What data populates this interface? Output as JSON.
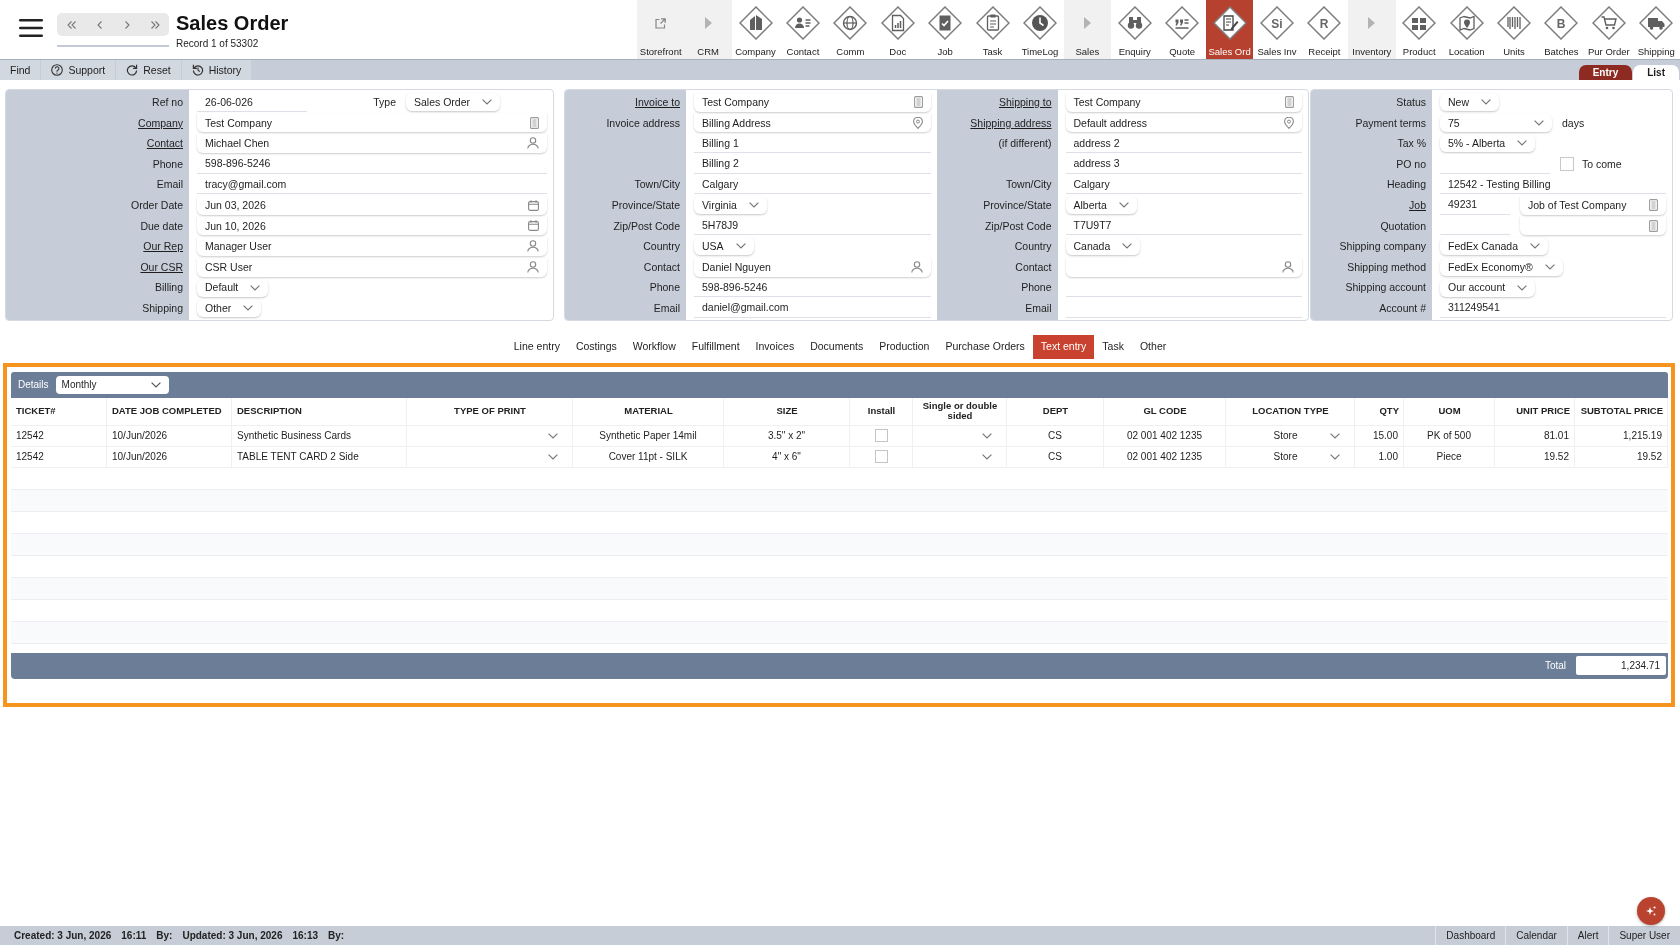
{
  "header": {
    "title": "Sales Order",
    "record": "Record 1 of 53302"
  },
  "toolbar": [
    {
      "label": "Storefront",
      "kind": "link",
      "selected": false
    },
    {
      "label": "CRM",
      "kind": "section",
      "selected": false
    },
    {
      "label": "Company",
      "kind": "module",
      "selected": false
    },
    {
      "label": "Contact",
      "kind": "module",
      "selected": false
    },
    {
      "label": "Comm",
      "kind": "module",
      "selected": false
    },
    {
      "label": "Doc",
      "kind": "module",
      "selected": false
    },
    {
      "label": "Job",
      "kind": "module",
      "selected": false
    },
    {
      "label": "Task",
      "kind": "module",
      "selected": false
    },
    {
      "label": "TimeLog",
      "kind": "module",
      "selected": false
    },
    {
      "label": "Sales",
      "kind": "section",
      "selected": false
    },
    {
      "label": "Enquiry",
      "kind": "module",
      "selected": false
    },
    {
      "label": "Quote",
      "kind": "module",
      "selected": false
    },
    {
      "label": "Sales Ord",
      "kind": "module",
      "selected": true
    },
    {
      "label": "Sales Inv",
      "kind": "module",
      "selected": false,
      "icon_text": "Si"
    },
    {
      "label": "Receipt",
      "kind": "module",
      "selected": false,
      "icon_text": "R"
    },
    {
      "label": "Inventory",
      "kind": "section",
      "selected": false
    },
    {
      "label": "Product",
      "kind": "module",
      "selected": false
    },
    {
      "label": "Location",
      "kind": "module",
      "selected": false
    },
    {
      "label": "Units",
      "kind": "module",
      "selected": false
    },
    {
      "label": "Batches",
      "kind": "module",
      "selected": false,
      "icon_text": "B"
    },
    {
      "label": "Pur Order",
      "kind": "module",
      "selected": false
    },
    {
      "label": "Shipping",
      "kind": "module",
      "selected": false
    }
  ],
  "actions": [
    "Find",
    "Support",
    "Reset",
    "History"
  ],
  "view_tabs": [
    {
      "label": "Entry",
      "selected": true
    },
    {
      "label": "List",
      "selected": false
    }
  ],
  "form": {
    "cards": [
      {
        "sections": [
          {
            "rows": [
              {
                "label": "Ref no",
                "link": false,
                "fields": [
                  {
                    "kind": "text",
                    "value": "26-06-026"
                  },
                  {
                    "kind": "caption",
                    "value": "Type"
                  },
                  {
                    "kind": "select",
                    "value": "Sales Order"
                  }
                ]
              },
              {
                "label": "Company",
                "link": true,
                "fields": [
                  {
                    "kind": "lookup",
                    "value": "Test Company"
                  }
                ]
              },
              {
                "label": "Contact",
                "link": true,
                "fields": [
                  {
                    "kind": "person",
                    "value": "Michael Chen"
                  }
                ]
              },
              {
                "label": "Phone",
                "link": false,
                "fields": [
                  {
                    "kind": "text",
                    "value": "598-896-5246"
                  }
                ]
              },
              {
                "label": "Email",
                "link": false,
                "fields": [
                  {
                    "kind": "text",
                    "value": "tracy@gmail.com"
                  }
                ]
              },
              {
                "label": "Order Date",
                "link": false,
                "fields": [
                  {
                    "kind": "date",
                    "value": "Jun 03, 2026"
                  }
                ]
              },
              {
                "label": "Due date",
                "link": false,
                "fields": [
                  {
                    "kind": "date",
                    "value": "Jun 10, 2026"
                  }
                ]
              },
              {
                "label": "Our Rep",
                "link": true,
                "fields": [
                  {
                    "kind": "person",
                    "value": "Manager User"
                  }
                ]
              },
              {
                "label": "Our CSR",
                "link": true,
                "fields": [
                  {
                    "kind": "person",
                    "value": "CSR User"
                  }
                ]
              },
              {
                "label": "Billing",
                "link": false,
                "fields": [
                  {
                    "kind": "select",
                    "value": "Default"
                  }
                ]
              },
              {
                "label": "Shipping",
                "link": false,
                "fields": [
                  {
                    "kind": "select",
                    "value": "Other"
                  }
                ]
              }
            ]
          }
        ]
      },
      {
        "sections": [
          {
            "rows": [
              {
                "label": "Invoice to",
                "link": true,
                "fields": [
                  {
                    "kind": "lookup",
                    "value": "Test Company"
                  }
                ]
              },
              {
                "label": "Invoice address",
                "link": false,
                "fields": [
                  {
                    "kind": "address",
                    "value": "Billing Address"
                  }
                ]
              },
              {
                "fields": [
                  {
                    "kind": "text",
                    "value": "Billing 1"
                  }
                ]
              },
              {
                "fields": [
                  {
                    "kind": "text",
                    "value": "Billing 2"
                  }
                ]
              },
              {
                "label": "Town/City",
                "link": false,
                "fields": [
                  {
                    "kind": "text",
                    "value": "Calgary"
                  }
                ]
              },
              {
                "label": "Province/State",
                "link": false,
                "fields": [
                  {
                    "kind": "select",
                    "value": "Virginia"
                  }
                ]
              },
              {
                "label": "Zip/Post Code",
                "link": false,
                "fields": [
                  {
                    "kind": "text",
                    "value": "5H78J9"
                  }
                ]
              },
              {
                "label": "Country",
                "link": false,
                "fields": [
                  {
                    "kind": "select",
                    "value": "USA"
                  }
                ]
              },
              {
                "label": "Contact",
                "link": false,
                "fields": [
                  {
                    "kind": "person",
                    "value": "Daniel Nguyen"
                  }
                ]
              },
              {
                "label": "Phone",
                "link": false,
                "fields": [
                  {
                    "kind": "text",
                    "value": "598-896-5246"
                  }
                ]
              },
              {
                "label": "Email",
                "link": false,
                "fields": [
                  {
                    "kind": "text",
                    "value": "daniel@gmail.com"
                  }
                ]
              }
            ]
          },
          {
            "rows": [
              {
                "label": "Shipping to",
                "link": true,
                "fields": [
                  {
                    "kind": "lookup",
                    "value": "Test Company"
                  }
                ]
              },
              {
                "label": "Shipping address",
                "link": true,
                "fields": [
                  {
                    "kind": "address",
                    "value": "Default address"
                  }
                ]
              },
              {
                "label": "(if different)",
                "link": false,
                "fields": [
                  {
                    "kind": "text",
                    "value": "address 2"
                  }
                ]
              },
              {
                "fields": [
                  {
                    "kind": "text",
                    "value": "address 3"
                  }
                ]
              },
              {
                "label": "Town/City",
                "link": false,
                "fields": [
                  {
                    "kind": "text",
                    "value": "Calgary"
                  }
                ]
              },
              {
                "label": "Province/State",
                "link": false,
                "fields": [
                  {
                    "kind": "select",
                    "value": "Alberta"
                  }
                ]
              },
              {
                "label": "Zip/Post Code",
                "link": false,
                "fields": [
                  {
                    "kind": "text",
                    "value": "T7U9T7"
                  }
                ]
              },
              {
                "label": "Country",
                "link": false,
                "fields": [
                  {
                    "kind": "select",
                    "value": "Canada"
                  }
                ]
              },
              {
                "label": "Contact",
                "link": false,
                "fields": [
                  {
                    "kind": "person"
                  }
                ]
              },
              {
                "label": "Phone",
                "link": false,
                "fields": [
                  {
                    "kind": "text"
                  }
                ]
              },
              {
                "label": "Email",
                "link": false,
                "fields": [
                  {
                    "kind": "text"
                  }
                ]
              }
            ]
          }
        ]
      },
      {
        "sections": [
          {
            "rows": [
              {
                "label": "Status",
                "link": false,
                "fields": [
                  {
                    "kind": "select",
                    "value": "New"
                  }
                ]
              },
              {
                "label": "Payment terms",
                "link": false,
                "fields": [
                  {
                    "kind": "select",
                    "value": "75"
                  },
                  {
                    "kind": "caption",
                    "value": "days"
                  }
                ]
              },
              {
                "label": "Tax %",
                "link": false,
                "fields": [
                  {
                    "kind": "select",
                    "value": "5% - Alberta"
                  }
                ]
              },
              {
                "label": "PO no",
                "link": false,
                "fields": [
                  {
                    "kind": "text"
                  },
                  {
                    "kind": "checkbox",
                    "label": "To come",
                    "checked": false
                  }
                ]
              },
              {
                "label": "Heading",
                "link": false,
                "fields": [
                  {
                    "kind": "text",
                    "value": "12542 - Testing Billing"
                  }
                ]
              },
              {
                "label": "Job",
                "link": true,
                "fields": [
                  {
                    "kind": "text",
                    "value": "49231"
                  },
                  {
                    "kind": "lookup",
                    "value": "Job of Test Company"
                  }
                ]
              },
              {
                "label": "Quotation",
                "link": false,
                "fields": [
                  {
                    "kind": "text"
                  },
                  {
                    "kind": "lookup"
                  }
                ]
              },
              {
                "label": "Shipping company",
                "link": false,
                "fields": [
                  {
                    "kind": "select",
                    "value": "FedEx Canada"
                  }
                ]
              },
              {
                "label": "Shipping method",
                "link": false,
                "fields": [
                  {
                    "kind": "select",
                    "value": "FedEx Economy®"
                  }
                ]
              },
              {
                "label": "Shipping account",
                "link": false,
                "fields": [
                  {
                    "kind": "select",
                    "value": "Our account"
                  }
                ]
              },
              {
                "label": "Account #",
                "link": false,
                "fields": [
                  {
                    "kind": "text",
                    "value": "311249541"
                  }
                ]
              }
            ]
          }
        ]
      }
    ]
  },
  "section_tabs": [
    {
      "label": "Line entry",
      "selected": false
    },
    {
      "label": "Costings",
      "selected": false
    },
    {
      "label": "Workflow",
      "selected": false
    },
    {
      "label": "Fulfillment",
      "selected": false
    },
    {
      "label": "Invoices",
      "selected": false
    },
    {
      "label": "Documents",
      "selected": false
    },
    {
      "label": "Production",
      "selected": false
    },
    {
      "label": "Purchase Orders",
      "selected": false
    },
    {
      "label": "Text entry",
      "selected": true
    },
    {
      "label": "Task",
      "selected": false
    },
    {
      "label": "Other",
      "selected": false
    }
  ],
  "grid": {
    "title": "Details",
    "period": "Monthly",
    "columns": [
      {
        "label": "TICKET#",
        "kind": "text"
      },
      {
        "label": "DATE JOB COMPLETED",
        "kind": "text"
      },
      {
        "label": "DESCRIPTION",
        "kind": "text"
      },
      {
        "label": "TYPE OF PRINT",
        "kind": "select"
      },
      {
        "label": "MATERIAL",
        "kind": "text"
      },
      {
        "label": "SIZE",
        "kind": "text"
      },
      {
        "label": "Install",
        "kind": "checkbox"
      },
      {
        "label": "Single or double sided",
        "kind": "select"
      },
      {
        "label": "DEPT",
        "kind": "text"
      },
      {
        "label": "GL CODE",
        "kind": "text"
      },
      {
        "label": "LOCATION TYPE",
        "kind": "select"
      },
      {
        "label": "QTY",
        "kind": "text"
      },
      {
        "label": "UOM",
        "kind": "text"
      },
      {
        "label": "UNIT PRICE",
        "kind": "text"
      },
      {
        "label": "SUBTOTAL PRICE",
        "kind": "text"
      }
    ],
    "rows": [
      {
        "cells": [
          {
            "value": "12542"
          },
          {
            "value": "10/Jun/2026"
          },
          {
            "value": "Synthetic Business Cards"
          },
          {},
          {
            "value": "Synthetic Paper 14mil"
          },
          {
            "value": "3.5\" x 2\""
          },
          {
            "checked": false
          },
          {},
          {
            "value": "CS"
          },
          {
            "value": "02 001 402 1235"
          },
          {
            "value": "Store"
          },
          {
            "value": "15.00"
          },
          {
            "value": "PK of 500"
          },
          {
            "value": "81.01"
          },
          {
            "value": "1,215.19"
          }
        ]
      },
      {
        "cells": [
          {
            "value": "12542"
          },
          {
            "value": "10/Jun/2026"
          },
          {
            "value": "TABLE TENT CARD 2 Side"
          },
          {},
          {
            "value": "Cover 11pt - SILK"
          },
          {
            "value": "4\" x 6\""
          },
          {
            "checked": false
          },
          {},
          {
            "value": "CS"
          },
          {
            "value": "02 001 402 1235"
          },
          {
            "value": "Store"
          },
          {
            "value": "1.00"
          },
          {
            "value": "Piece"
          },
          {
            "value": "19.52"
          },
          {
            "value": "19.52"
          }
        ]
      }
    ],
    "total_label": "Total",
    "total": "1,234.71"
  },
  "status_bar": {
    "left": [
      "Created: 3 Jun, 2026",
      "16:11",
      "By:",
      "Updated: 3 Jun, 2026",
      "16:13",
      "By:"
    ],
    "right": [
      "Dashboard",
      "Calendar",
      "Alert",
      "Super User"
    ]
  }
}
